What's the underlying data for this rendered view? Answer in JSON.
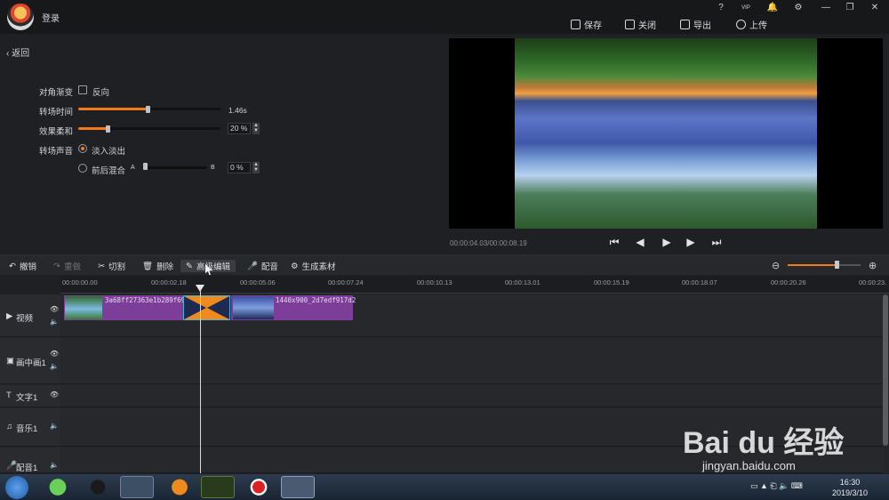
{
  "app": {
    "login_label": "登录"
  },
  "titlebar": {
    "window_icons": [
      "?",
      "VIP",
      "🔔",
      "⚙",
      "—",
      "❐",
      "✕"
    ],
    "actions": [
      {
        "label": "保存",
        "icon": "save-icon"
      },
      {
        "label": "关闭",
        "icon": "close-project-icon"
      },
      {
        "label": "导出",
        "icon": "export-icon"
      },
      {
        "label": "上传",
        "icon": "upload-icon"
      }
    ]
  },
  "panel": {
    "back_label": "返回",
    "diagonal": {
      "label": "对角渐变",
      "checkbox_label": "反向",
      "checked": false
    },
    "duration": {
      "label": "转场时间",
      "value": "1.46s",
      "fraction": 0.5
    },
    "softness": {
      "label": "效果柔和",
      "value": "20 %",
      "fraction": 0.2
    },
    "sound": {
      "label": "转场声音",
      "option1": "淡入淡出",
      "option2": "前后混合",
      "selected": "淡入淡出",
      "a_label": "A",
      "b_label": "B",
      "mix_value": "0 %"
    }
  },
  "preview": {
    "timecode": "00:00:04.03/00:00:08.19"
  },
  "toolbar": {
    "items": [
      {
        "label": "撤销",
        "enabled": true
      },
      {
        "label": "重做",
        "enabled": false
      },
      {
        "label": "切割",
        "enabled": true
      },
      {
        "label": "删除",
        "enabled": true
      },
      {
        "label": "高级编辑",
        "enabled": true
      },
      {
        "label": "配音",
        "enabled": true
      },
      {
        "label": "生成素材",
        "enabled": true
      }
    ],
    "zoom_fraction": 0.68
  },
  "ruler": {
    "ticks": [
      "00:00:00.00",
      "00:00:02.18",
      "00:00:05.06",
      "00:00:07.24",
      "00:00:10.13",
      "00:00:13.01",
      "00:00:15.19",
      "00:00:18.07",
      "00:00:20.26",
      "00:00:23."
    ]
  },
  "tracks": [
    {
      "label": "视频",
      "icon": "video-track-icon"
    },
    {
      "label": "画中画1",
      "icon": "pip-track-icon"
    },
    {
      "label": "文字1",
      "icon": "text-track-icon"
    },
    {
      "label": "音乐1",
      "icon": "music-track-icon"
    },
    {
      "label": "配音1",
      "icon": "mic-track-icon"
    }
  ],
  "clips": {
    "clip1_name": "3a68ff27363e1b289f69",
    "clip2_name": "1440x900_2d7edf917d2"
  },
  "taskbar": {
    "time": "16:30",
    "date": "2019/3/10"
  },
  "watermark": {
    "brand": "Bai du 经验",
    "url": "jingyan.baidu.com"
  }
}
